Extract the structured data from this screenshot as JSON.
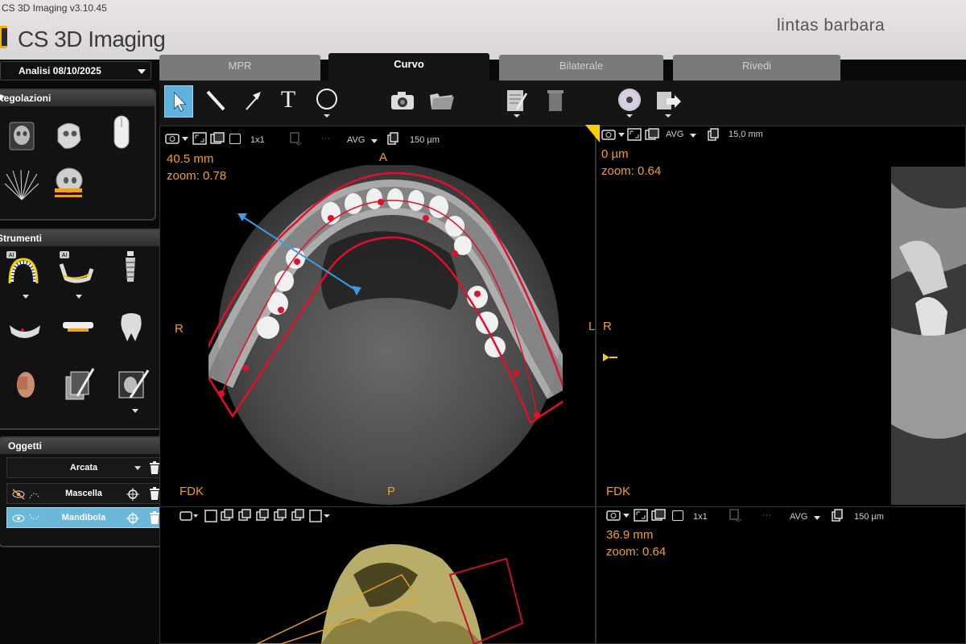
{
  "window": {
    "title": "CS 3D Imaging v3.10.45",
    "app_name": "CS 3D Imaging",
    "user": "lintas barbara"
  },
  "tabs": [
    {
      "label": "MPR",
      "active": false
    },
    {
      "label": "Curvo",
      "active": true
    },
    {
      "label": "Bilaterale",
      "active": false
    },
    {
      "label": "Rivedi",
      "active": false
    }
  ],
  "analysis": {
    "label": "Analisi 08/10/2025"
  },
  "panels": {
    "regolazioni": {
      "title": "Regolazioni"
    },
    "strumenti": {
      "title": "Strumenti",
      "ai_badge": "AI"
    },
    "oggetti": {
      "title": "Oggetti",
      "arcata": "Arcata",
      "items": [
        {
          "label": "Mascella",
          "selected": false
        },
        {
          "label": "Mandibola",
          "selected": true
        }
      ]
    }
  },
  "toolbar": {
    "text_tool": "T"
  },
  "viewport_axial": {
    "thickness_mode": "1x1",
    "render_mode": "AVG",
    "slice_width": "150 µm",
    "distance": "40.5 mm",
    "zoom": "zoom: 0.78",
    "orient_top": "A",
    "orient_left": "R",
    "orient_right": "L"
  },
  "viewport_curved": {
    "render_mode": "AVG",
    "slice_width": "15,0 mm",
    "distance": "0 µm",
    "zoom": "zoom: 0.64",
    "orient_right": "R"
  },
  "viewport_3d": {
    "label": "FDK",
    "orient_top": "P"
  },
  "viewport_cross": {
    "label": "FDK",
    "thickness_mode": "1x1",
    "render_mode": "AVG",
    "slice_width": "150 µm",
    "distance": "36.9 mm",
    "zoom": "zoom: 0.64"
  },
  "colors": {
    "accent": "#5fb2dd",
    "overlay_text": "#f0a020",
    "curve": "#e0102a",
    "marker": "#3a9be8",
    "highlight": "#f4d000"
  }
}
